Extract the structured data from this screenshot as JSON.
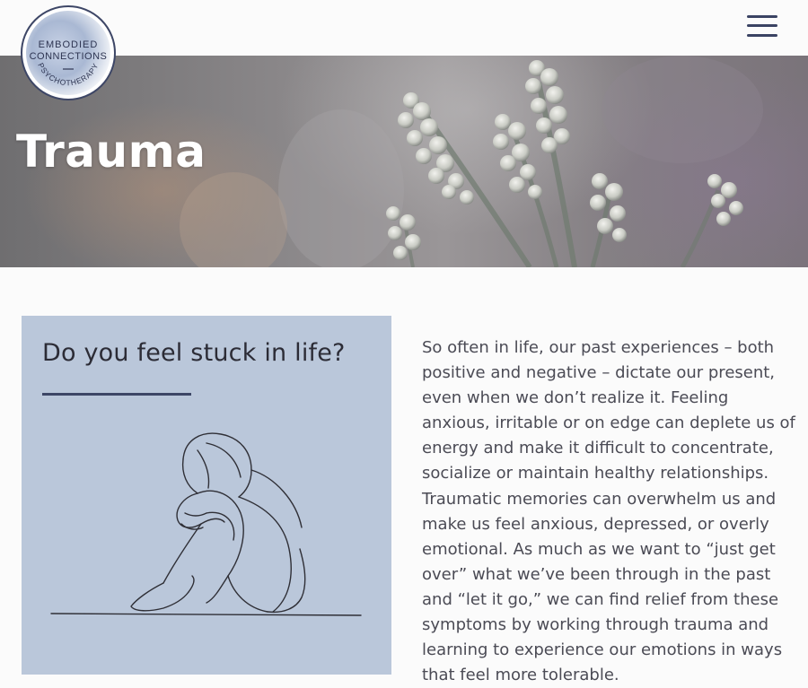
{
  "header": {
    "logo": {
      "line1": "EMBODIED",
      "line2": "CONNECTIONS",
      "line3": "PSYCHOTHERAPY"
    },
    "menu_icon": "hamburger-menu-icon"
  },
  "hero": {
    "title": "Trauma"
  },
  "card": {
    "heading": "Do you feel stuck in life?",
    "illustration": "person-sitting-hugging-knees-line-drawing"
  },
  "body": {
    "paragraph": "So often in life, our past experiences – both positive and negative – dictate our present, even when we don’t realize it. Feeling anxious, irritable or on edge can deplete us of energy and make it difficult to concentrate, socialize or maintain healthy relationships. Traumatic memories can overwhelm us and make us feel anxious, depressed, or overly emotional. As much as we want to “just get over” what we’ve been through in the past and “let it go,” we can find relief from these symptoms by working through trauma and learning to experience our emotions in ways that feel more tolerable."
  },
  "colors": {
    "accent": "#3d4666",
    "card_bg": "#bac7da",
    "text": "#4b4b55"
  }
}
